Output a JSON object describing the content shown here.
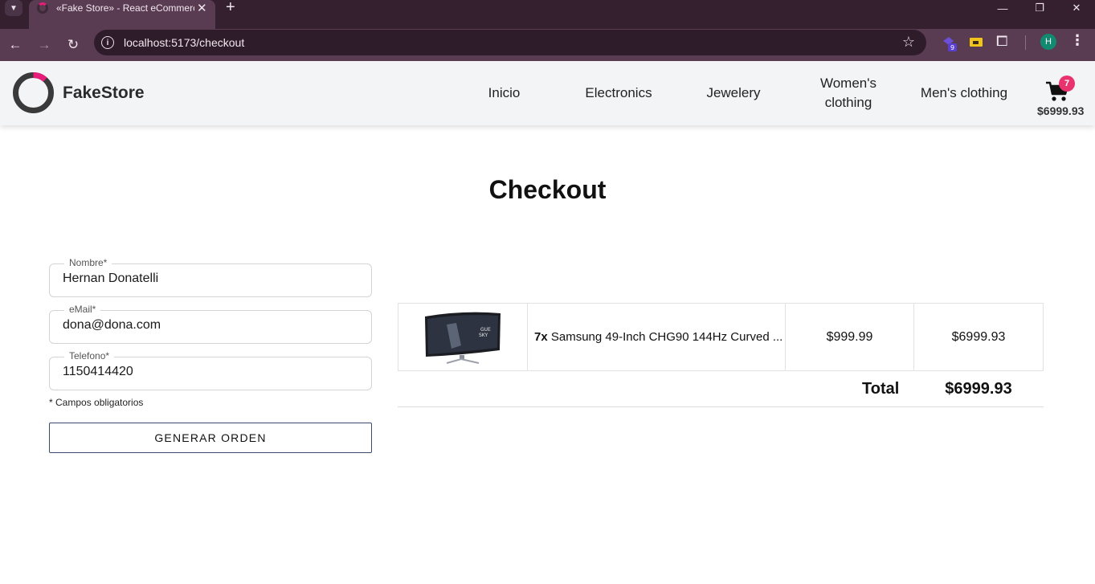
{
  "browser": {
    "tab_title": "«Fake Store» - React eCommerce",
    "url": "localhost:5173/checkout",
    "extension_badge": "9",
    "profile_initial": "H"
  },
  "site": {
    "brand": "FakeStore",
    "brand_accent_color": "#e81c7a",
    "nav": [
      {
        "label": "Inicio"
      },
      {
        "label": "Electronics"
      },
      {
        "label": "Jewelery"
      },
      {
        "label": "Women's clothing"
      },
      {
        "label": "Men's clothing"
      }
    ],
    "cart": {
      "count": "7",
      "total": "$6999.93"
    }
  },
  "page": {
    "title": "Checkout"
  },
  "form": {
    "fields": [
      {
        "label": "Nombre*",
        "value": "Hernan Donatelli"
      },
      {
        "label": "eMail*",
        "value": "dona@dona.com"
      },
      {
        "label": "Telefono*",
        "value": "1150414420"
      }
    ],
    "required_note": "* Campos obligatorios",
    "submit_label": "GENERAR ORDEN"
  },
  "order": {
    "items": [
      {
        "image": "curved-monitor",
        "quantity": "7x",
        "name": "Samsung 49-Inch CHG90 144Hz Curved ...",
        "unit_price": "$999.99",
        "subtotal": "$6999.93"
      }
    ],
    "total_label": "Total",
    "total_value": "$6999.93"
  }
}
